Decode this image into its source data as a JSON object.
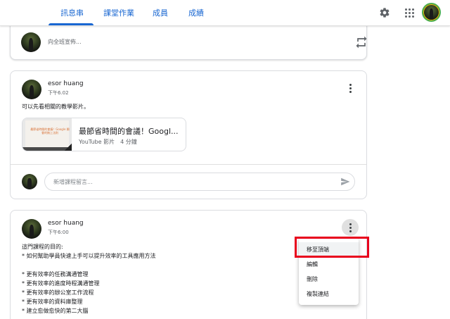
{
  "nav": {
    "tabs": [
      {
        "label": "訊息串"
      },
      {
        "label": "課堂作業"
      },
      {
        "label": "成員"
      },
      {
        "label": "成績"
      }
    ],
    "active_tab": "訊息串"
  },
  "icons": {
    "settings": "gear-icon",
    "apps": "apps-grid-icon",
    "repost": "repost-icon",
    "more": "more-vert-icon",
    "send": "send-icon"
  },
  "announce": {
    "placeholder": "向全班宣佈..."
  },
  "post1": {
    "author": "esor huang",
    "time": "下午6.02",
    "body": "可以先看相關的教學影片。",
    "attachment": {
      "title": "最節省時間的會議！Googl...",
      "subtitle": "YouTube 影片　4 分鐘",
      "thumb_text": "最節省時間的會議！Google 開會的無上法則"
    },
    "comment_placeholder": "新增課程留言..."
  },
  "post2": {
    "author": "esor huang",
    "time": "下午6:00",
    "body": "這門課程的目的:\n* 如何幫助學員快速上手可以提升效率的工具應用方法\n\n* 更有效率的任務溝通管理\n* 更有效率的進度時程溝通管理\n* 更有效率的辦公室工作流程\n* 更有效率的資料庫整理\n* 建立愈做愈快的第二大腦"
  },
  "menu": {
    "items": [
      "移至頂端",
      "編輯",
      "刪除",
      "複製連結"
    ]
  },
  "colors": {
    "accent": "#1967d2",
    "highlight": "#e8001c"
  }
}
